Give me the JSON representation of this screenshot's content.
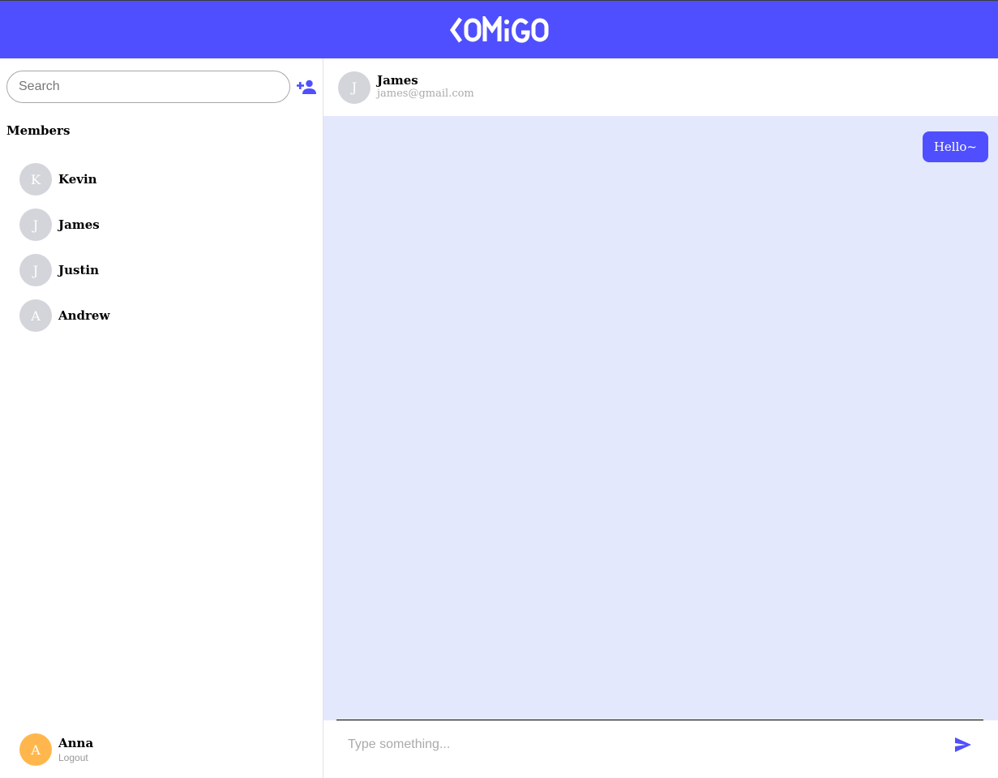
{
  "app": {
    "logo_text": "COMIGO"
  },
  "sidebar": {
    "search": {
      "placeholder": "Search",
      "value": ""
    },
    "add_user_icon": "person-add-icon",
    "members_title": "Members",
    "members": [
      {
        "initial": "K",
        "name": "Kevin"
      },
      {
        "initial": "J",
        "name": "James"
      },
      {
        "initial": "J",
        "name": "Justin"
      },
      {
        "initial": "A",
        "name": "Andrew"
      }
    ],
    "current_user": {
      "initial": "A",
      "name": "Anna",
      "logout_label": "Logout"
    }
  },
  "chat": {
    "header": {
      "initial": "J",
      "name": "James",
      "email": "james@gmail.com"
    },
    "messages": [
      {
        "text": "Hello~",
        "direction": "outgoing"
      }
    ],
    "composer": {
      "placeholder": "Type something...",
      "value": "",
      "send_icon": "send-icon"
    }
  },
  "colors": {
    "brand": "#4f4fff",
    "chat_background": "#e4e8fd",
    "avatar_default": "#d3d5da",
    "avatar_current_user": "#ffb74d"
  }
}
